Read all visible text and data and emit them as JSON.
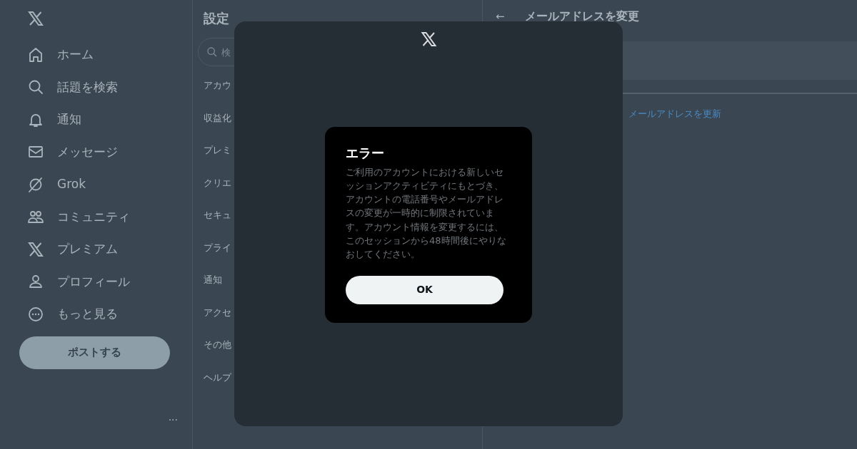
{
  "nav": {
    "items": [
      {
        "label": "ホーム"
      },
      {
        "label": "話題を検索"
      },
      {
        "label": "通知"
      },
      {
        "label": "メッセージ"
      },
      {
        "label": "Grok"
      },
      {
        "label": "コミュニティ"
      },
      {
        "label": "プレミアム"
      },
      {
        "label": "プロフィール"
      },
      {
        "label": "もっと見る"
      }
    ],
    "post_button": "ポストする",
    "more": "···"
  },
  "settings": {
    "title": "設定",
    "search": {
      "placeholder": "検"
    },
    "items": [
      "アカウ",
      "収益化",
      "プレミ",
      "クリエ",
      "セキュ",
      "プライ",
      "通知",
      "アクセ",
      "その他",
      "ヘルプ"
    ]
  },
  "detail": {
    "back": "←",
    "title": "メールアドレスを変更",
    "link": "メールアドレスを更新"
  },
  "dialog": {
    "title": "エラー",
    "message": "ご利用のアカウントにおける新しいセッションアクティビティにもとづき、アカウントの電話番号やメールアドレスの変更が一時的に制限されています。アカウント情報を変更するには、このセッションから48時間後にやりなおしてください。",
    "button": "OK"
  }
}
